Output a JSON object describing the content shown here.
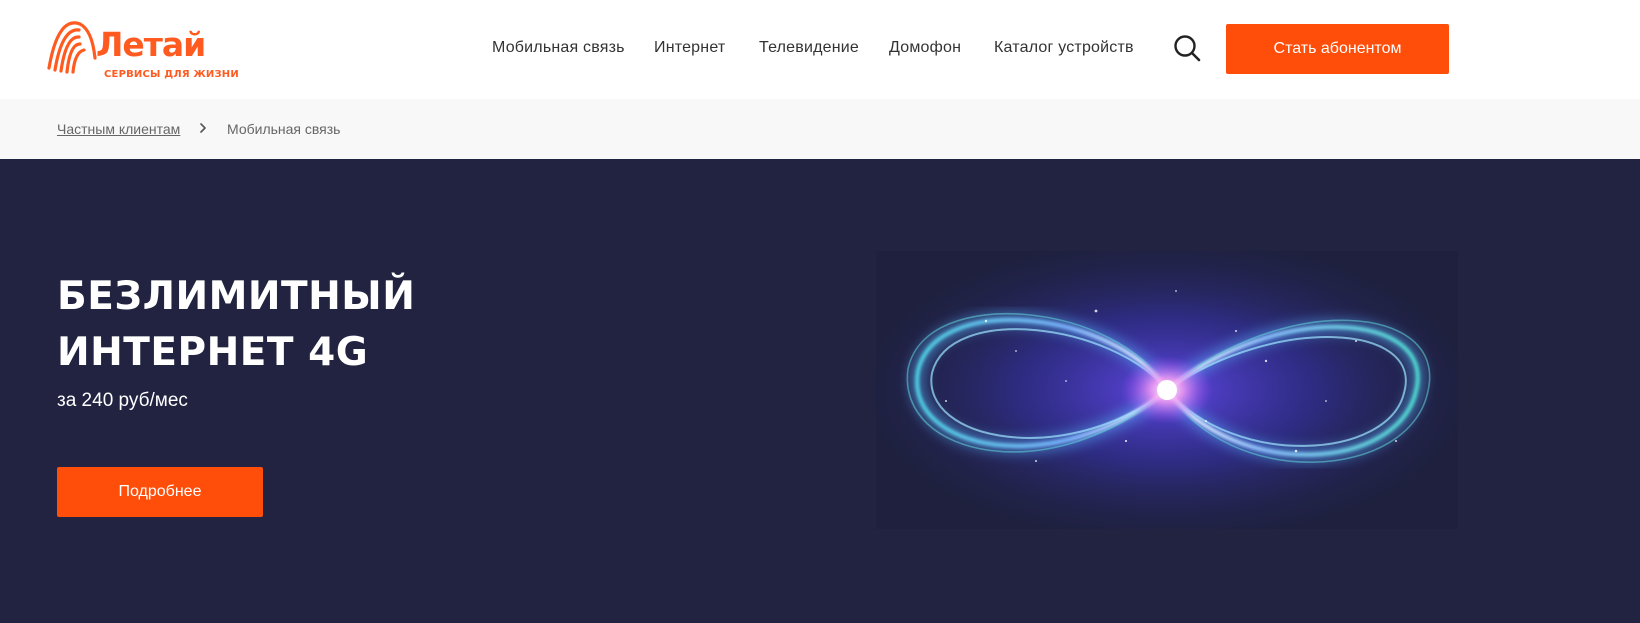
{
  "brand": {
    "name": "Летай",
    "tagline": "СЕРВИСЫ ДЛЯ ЖИЗНИ",
    "color": "#ff5a1f"
  },
  "nav": {
    "items": [
      {
        "label": "Мобильная связь"
      },
      {
        "label": "Интернет"
      },
      {
        "label": "Телевидение"
      },
      {
        "label": "Домофон"
      },
      {
        "label": "Каталог устройств"
      }
    ],
    "search_icon": "search-icon",
    "cta_label": "Стать абонентом"
  },
  "breadcrumb": {
    "items": [
      {
        "label": "Частным клиентам"
      },
      {
        "label": "Мобильная связь"
      }
    ],
    "separator_icon": "chevron-right-icon"
  },
  "hero": {
    "title_line1": "БЕЗЛИМИТНЫЙ",
    "title_line2": "ИНТЕРНЕТ 4G",
    "price": "за 240 руб/мес",
    "button_label": "Подробнее",
    "image_icon": "infinity-icon",
    "background_color": "#212341"
  },
  "colors": {
    "accent": "#ff4d0a",
    "text": "#333333",
    "breadcrumb_bg": "#f8f8f8"
  }
}
